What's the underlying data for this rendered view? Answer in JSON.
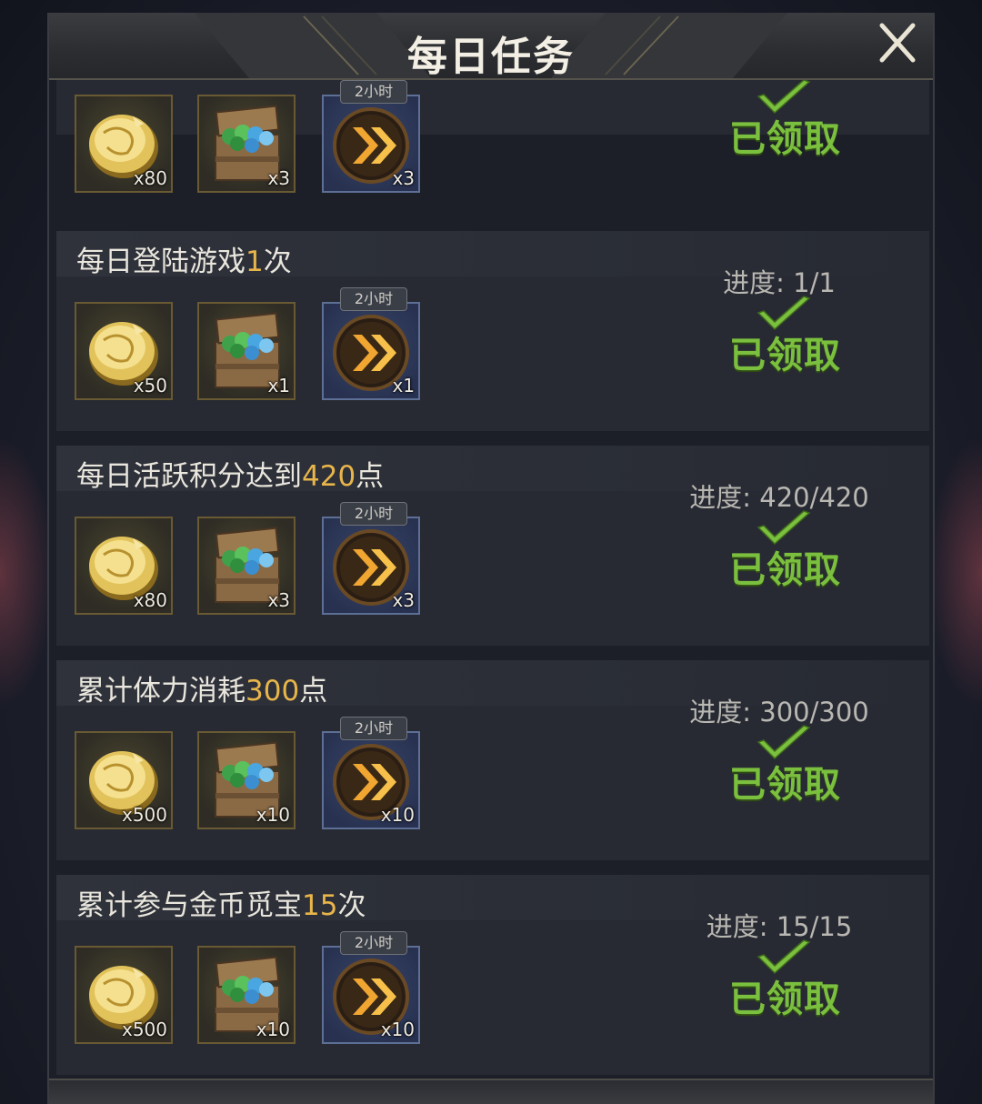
{
  "window": {
    "title": "每日任务",
    "close_icon": "close-icon"
  },
  "tasks": [
    {
      "name_parts": [],
      "progress": "",
      "status": "已领取",
      "rewards": [
        {
          "type": "gold-coin",
          "qty": "x80"
        },
        {
          "type": "resource-chest",
          "qty": "x3"
        },
        {
          "type": "speedup",
          "qty": "x3",
          "tag": "2小时"
        }
      ]
    },
    {
      "name_parts": [
        {
          "t": "每日登陆游戏",
          "hl": false
        },
        {
          "t": "1",
          "hl": true
        },
        {
          "t": "次",
          "hl": false
        }
      ],
      "progress": "进度: 1/1",
      "status": "已领取",
      "rewards": [
        {
          "type": "gold-coin",
          "qty": "x50"
        },
        {
          "type": "resource-chest",
          "qty": "x1"
        },
        {
          "type": "speedup",
          "qty": "x1",
          "tag": "2小时"
        }
      ]
    },
    {
      "name_parts": [
        {
          "t": "每日活跃积分达到",
          "hl": false
        },
        {
          "t": "420",
          "hl": true
        },
        {
          "t": "点",
          "hl": false
        }
      ],
      "progress": "进度: 420/420",
      "status": "已领取",
      "rewards": [
        {
          "type": "gold-coin",
          "qty": "x80"
        },
        {
          "type": "resource-chest",
          "qty": "x3"
        },
        {
          "type": "speedup",
          "qty": "x3",
          "tag": "2小时"
        }
      ]
    },
    {
      "name_parts": [
        {
          "t": "累计体力消耗",
          "hl": false
        },
        {
          "t": "300",
          "hl": true
        },
        {
          "t": "点",
          "hl": false
        }
      ],
      "progress": "进度: 300/300",
      "status": "已领取",
      "rewards": [
        {
          "type": "gold-coin",
          "qty": "x500"
        },
        {
          "type": "resource-chest",
          "qty": "x10"
        },
        {
          "type": "speedup",
          "qty": "x10",
          "tag": "2小时"
        }
      ]
    },
    {
      "name_parts": [
        {
          "t": "累计参与金币觅宝",
          "hl": false
        },
        {
          "t": "15",
          "hl": true
        },
        {
          "t": "次",
          "hl": false
        }
      ],
      "progress": "进度: 15/15",
      "status": "已领取",
      "rewards": [
        {
          "type": "gold-coin",
          "qty": "x500"
        },
        {
          "type": "resource-chest",
          "qty": "x10"
        },
        {
          "type": "speedup",
          "qty": "x10",
          "tag": "2小时"
        }
      ]
    }
  ],
  "colors": {
    "highlight": "#e8b54a",
    "claimed": "#7bbf3e",
    "text": "#e9e6dd"
  }
}
